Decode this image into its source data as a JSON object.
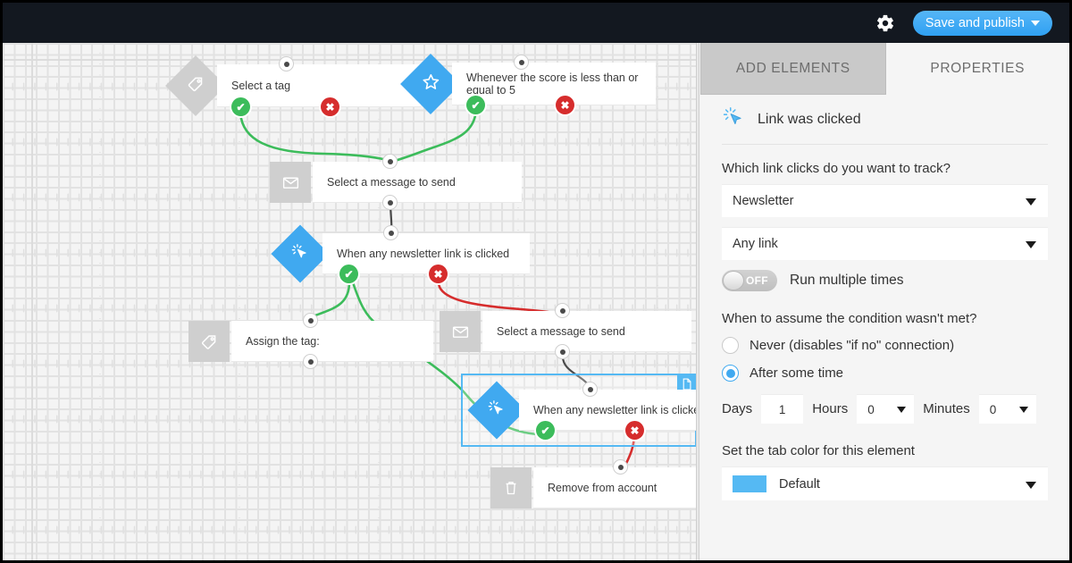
{
  "topbar": {
    "gear_icon": "gear-icon",
    "save_label": "Save and publish"
  },
  "panel": {
    "tabs": [
      {
        "label": "ADD ELEMENTS",
        "active": false
      },
      {
        "label": "PROPERTIES",
        "active": true
      }
    ],
    "element": {
      "icon": "click-cursor-icon",
      "title": "Link was clicked"
    },
    "link_question": "Which link clicks do you want to track?",
    "link_source_value": "Newsletter",
    "link_which_value": "Any link",
    "run_multiple": {
      "toggle_state": "OFF",
      "label": "Run multiple times"
    },
    "condition_question": "When to assume the condition wasn't met?",
    "radio_never": {
      "label": "Never (disables \"if no\" connection)",
      "selected": false
    },
    "radio_after": {
      "label": "After some time",
      "selected": true
    },
    "time": {
      "days_label": "Days",
      "days_value": "1",
      "hours_label": "Hours",
      "hours_value": "0",
      "minutes_label": "Minutes",
      "minutes_value": "0"
    },
    "tab_color_question": "Set the tab color for this element",
    "tab_color_value": "Default",
    "tab_color_hex": "#55b9f3"
  },
  "canvas": {
    "nodes": [
      {
        "id": "n1",
        "label": "Select a tag",
        "shape": "diamond",
        "color": "gray",
        "icon": "tag-icon"
      },
      {
        "id": "n2",
        "label": "Whenever the score is less than or equal to 5",
        "shape": "diamond",
        "color": "blue",
        "icon": "star-icon"
      },
      {
        "id": "n3",
        "label": "Select a message to send",
        "shape": "square",
        "color": "gray",
        "icon": "envelope-icon"
      },
      {
        "id": "n4",
        "label": "When any newsletter link is clicked",
        "shape": "diamond",
        "color": "blue",
        "icon": "click-cursor-icon"
      },
      {
        "id": "n5",
        "label": "Assign the tag:",
        "shape": "square",
        "color": "gray",
        "icon": "tag-icon"
      },
      {
        "id": "n6",
        "label": "Select a message to send",
        "shape": "square",
        "color": "gray",
        "icon": "envelope-icon"
      },
      {
        "id": "n7",
        "label": "When any newsletter link is clicked",
        "shape": "diamond",
        "color": "blue",
        "icon": "click-cursor-icon",
        "selected": true,
        "badge_icon": "copy-document-icon"
      },
      {
        "id": "n8",
        "label": "Remove from account",
        "shape": "square",
        "color": "gray",
        "icon": "trash-icon"
      }
    ],
    "badges": {
      "yes": "✔",
      "no": "✖"
    },
    "edge_yes_color": "#3cbc5b",
    "edge_no_color": "#d62d2d",
    "edge_neutral_color": "#4a4a4a"
  }
}
